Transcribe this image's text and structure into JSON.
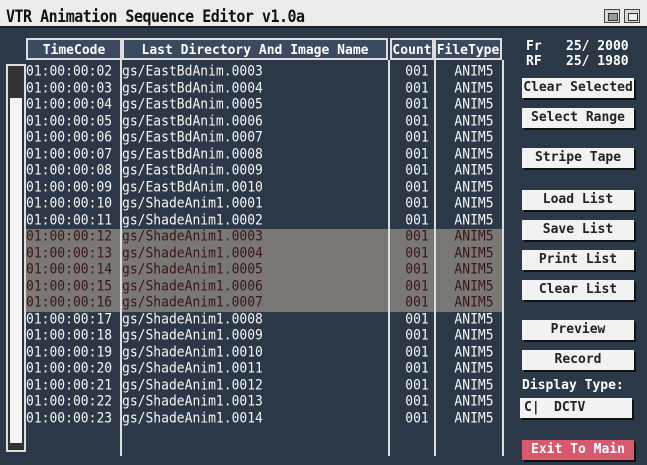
{
  "window": {
    "title": "VTR Animation Sequence Editor v1.0a"
  },
  "columns": {
    "timecode": "TimeCode",
    "name": "Last Directory And Image Name",
    "count": "Count",
    "filetype": "FileType"
  },
  "info": {
    "fr_label": "Fr",
    "fr_value": "25/ 2000",
    "rf_label": "RF",
    "rf_value": "25/ 1980"
  },
  "rows": [
    {
      "timecode": "01:00:00:02",
      "name": "gs/EastBdAnim.0003",
      "count": "001",
      "filetype": "ANIM5"
    },
    {
      "timecode": "01:00:00:03",
      "name": "gs/EastBdAnim.0004",
      "count": "001",
      "filetype": "ANIM5"
    },
    {
      "timecode": "01:00:00:04",
      "name": "gs/EastBdAnim.0005",
      "count": "001",
      "filetype": "ANIM5"
    },
    {
      "timecode": "01:00:00:05",
      "name": "gs/EastBdAnim.0006",
      "count": "001",
      "filetype": "ANIM5"
    },
    {
      "timecode": "01:00:00:06",
      "name": "gs/EastBdAnim.0007",
      "count": "001",
      "filetype": "ANIM5"
    },
    {
      "timecode": "01:00:00:07",
      "name": "gs/EastBdAnim.0008",
      "count": "001",
      "filetype": "ANIM5"
    },
    {
      "timecode": "01:00:00:08",
      "name": "gs/EastBdAnim.0009",
      "count": "001",
      "filetype": "ANIM5"
    },
    {
      "timecode": "01:00:00:09",
      "name": "gs/EastBdAnim.0010",
      "count": "001",
      "filetype": "ANIM5"
    },
    {
      "timecode": "01:00:00:10",
      "name": "gs/ShadeAnim1.0001",
      "count": "001",
      "filetype": "ANIM5"
    },
    {
      "timecode": "01:00:00:11",
      "name": "gs/ShadeAnim1.0002",
      "count": "001",
      "filetype": "ANIM5"
    },
    {
      "timecode": "01:00:00:12",
      "name": "gs/ShadeAnim1.0003",
      "count": "001",
      "filetype": "ANIM5",
      "selected": true
    },
    {
      "timecode": "01:00:00:13",
      "name": "gs/ShadeAnim1.0004",
      "count": "001",
      "filetype": "ANIM5",
      "selected": true
    },
    {
      "timecode": "01:00:00:14",
      "name": "gs/ShadeAnim1.0005",
      "count": "001",
      "filetype": "ANIM5",
      "selected": true
    },
    {
      "timecode": "01:00:00:15",
      "name": "gs/ShadeAnim1.0006",
      "count": "001",
      "filetype": "ANIM5",
      "selected": true
    },
    {
      "timecode": "01:00:00:16",
      "name": "gs/ShadeAnim1.0007",
      "count": "001",
      "filetype": "ANIM5",
      "selected": true
    },
    {
      "timecode": "01:00:00:17",
      "name": "gs/ShadeAnim1.0008",
      "count": "001",
      "filetype": "ANIM5"
    },
    {
      "timecode": "01:00:00:18",
      "name": "gs/ShadeAnim1.0009",
      "count": "001",
      "filetype": "ANIM5"
    },
    {
      "timecode": "01:00:00:19",
      "name": "gs/ShadeAnim1.0010",
      "count": "001",
      "filetype": "ANIM5"
    },
    {
      "timecode": "01:00:00:20",
      "name": "gs/ShadeAnim1.0011",
      "count": "001",
      "filetype": "ANIM5"
    },
    {
      "timecode": "01:00:00:21",
      "name": "gs/ShadeAnim1.0012",
      "count": "001",
      "filetype": "ANIM5"
    },
    {
      "timecode": "01:00:00:22",
      "name": "gs/ShadeAnim1.0013",
      "count": "001",
      "filetype": "ANIM5"
    },
    {
      "timecode": "01:00:00:23",
      "name": "gs/ShadeAnim1.0014",
      "count": "001",
      "filetype": "ANIM5"
    }
  ],
  "buttons": {
    "clear_selected": "Clear Selected",
    "select_range": "Select Range",
    "stripe_tape": "Stripe Tape",
    "load_list": "Load List",
    "save_list": "Save List",
    "print_list": "Print List",
    "clear_list": "Clear List",
    "preview": "Preview",
    "record": "Record",
    "exit": "Exit To Main"
  },
  "display_type": {
    "label": "Display Type:",
    "icon": "cycle-icon",
    "value": "DCTV"
  },
  "colors": {
    "background": "#2a3848",
    "selected_row": "#7a7874",
    "exit_button": "#d8586e"
  }
}
